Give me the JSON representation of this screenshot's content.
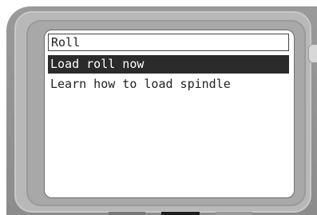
{
  "screen": {
    "title": "Roll",
    "menu_items": [
      {
        "label": "Load roll now",
        "selected": true
      },
      {
        "label": "Learn how to load spindle",
        "selected": false
      }
    ]
  },
  "colors": {
    "highlight_background": "#2b2b2b",
    "highlight_text": "#ffffff",
    "text": "#222222",
    "bezel": "#a8a8a8"
  }
}
